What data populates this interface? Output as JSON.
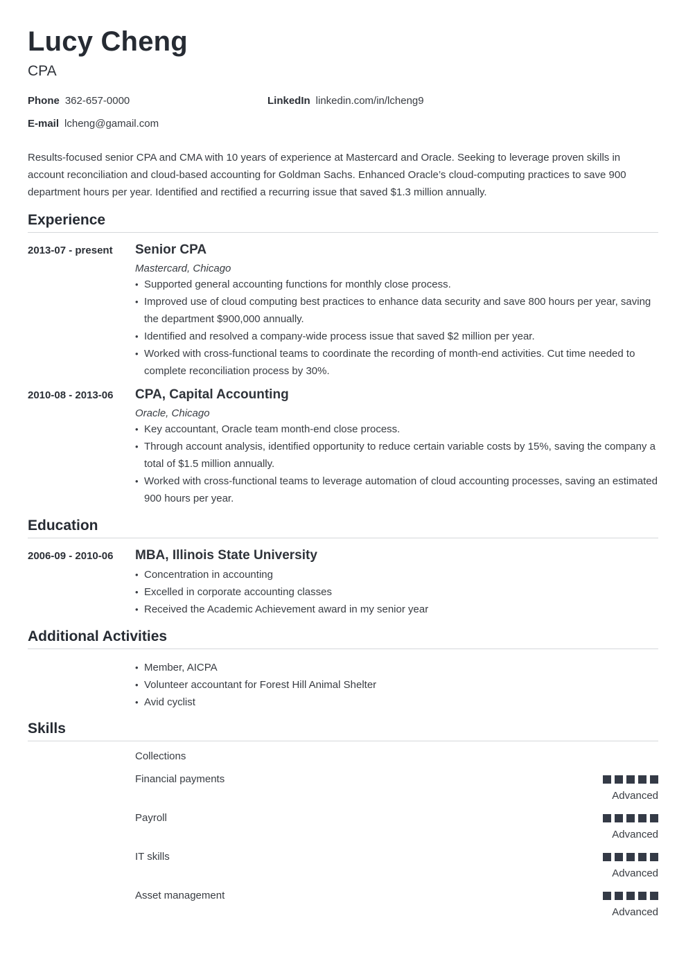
{
  "header": {
    "name": "Lucy Cheng",
    "title": "CPA"
  },
  "contacts": {
    "phone": {
      "label": "Phone",
      "value": "362-657-0000"
    },
    "linkedin": {
      "label": "LinkedIn",
      "value": "linkedin.com/in/lcheng9"
    },
    "email": {
      "label": "E-mail",
      "value": "lcheng@gamail.com"
    }
  },
  "summary": "Results-focused senior CPA and CMA with 10 years of experience at Mastercard and Oracle. Seeking to leverage proven skills in account reconciliation and cloud-based accounting for Goldman Sachs. Enhanced Oracle’s cloud-computing practices to save 900 department hours per year. Identified and rectified a recurring issue that saved $1.3 million annually.",
  "sections": {
    "experience": "Experience",
    "education": "Education",
    "activities": "Additional Activities",
    "skills": "Skills"
  },
  "experience": [
    {
      "dates": "2013-07 - present",
      "role": "Senior CPA",
      "org": "Mastercard, Chicago",
      "bullets": [
        "Supported general accounting functions for monthly close process.",
        "Improved use of cloud computing best practices to enhance data security and save 800 hours per year, saving the department $900,000 annually.",
        "Identified and resolved a company-wide process issue that saved $2 million per year.",
        "Worked with cross-functional teams to coordinate the recording of month-end activities. Cut time needed to complete reconciliation process by 30%."
      ]
    },
    {
      "dates": "2010-08 - 2013-06",
      "role": "CPA, Capital Accounting",
      "org": "Oracle, Chicago",
      "bullets": [
        "Key accountant, Oracle team month-end close process.",
        "Through account analysis, identified opportunity to reduce certain variable costs by 15%, saving the company a total of $1.5 million annually.",
        "Worked with cross-functional teams to leverage automation of cloud accounting processes, saving an estimated 900 hours per year."
      ]
    }
  ],
  "education": [
    {
      "dates": "2006-09 - 2010-06",
      "degree": "MBA, Illinois State University",
      "bullets": [
        "Concentration in accounting",
        "Excelled in corporate accounting classes",
        "Received the Academic Achievement award in my senior year"
      ]
    }
  ],
  "activities": [
    "Member, AICPA",
    "Volunteer accountant for Forest Hill Animal Shelter",
    "Avid cyclist"
  ],
  "skills": [
    {
      "name": "Collections"
    },
    {
      "name": "Financial payments",
      "rating": 5,
      "max": 5,
      "level": "Advanced"
    },
    {
      "name": "Payroll",
      "rating": 5,
      "max": 5,
      "level": "Advanced"
    },
    {
      "name": "IT skills",
      "rating": 5,
      "max": 5,
      "level": "Advanced"
    },
    {
      "name": "Asset management",
      "rating": 5,
      "max": 5,
      "level": "Advanced"
    }
  ],
  "colors": {
    "text": "#383c42",
    "heading": "#262b33",
    "rating_fill": "#343a46",
    "rule": "#d5d7da"
  }
}
